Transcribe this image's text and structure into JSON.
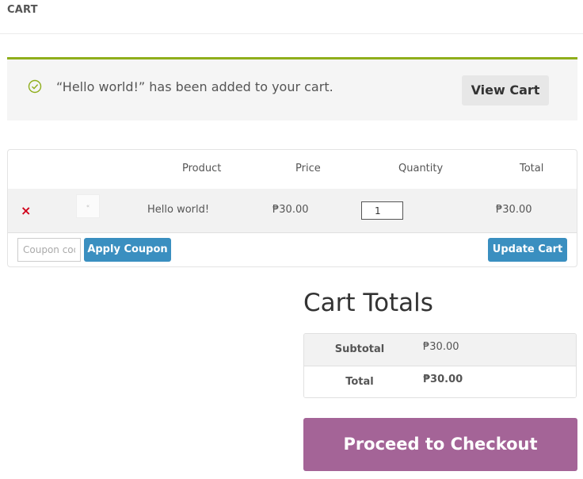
{
  "page": {
    "title": "CART"
  },
  "notice": {
    "message": "“Hello world!” has been added to your cart.",
    "view_cart_label": "View Cart",
    "accent_color": "#8fae1b",
    "icon": "check-circle-icon"
  },
  "cart": {
    "columns": {
      "product": "Product",
      "price": "Price",
      "quantity": "Quantity",
      "total": "Total"
    },
    "items": [
      {
        "remove_icon": "×",
        "thumb_text": "«",
        "name": "Hello world!",
        "price": "₱30.00",
        "quantity": "1",
        "total": "₱30.00"
      }
    ],
    "coupon_placeholder": "Coupon code",
    "apply_coupon_label": "Apply Coupon",
    "update_cart_label": "Update Cart",
    "button_color": "#3a8fc0"
  },
  "totals": {
    "title": "Cart Totals",
    "subtotal_label": "Subtotal",
    "subtotal_value": "₱30.00",
    "total_label": "Total",
    "total_value": "₱30.00"
  },
  "checkout": {
    "label": "Proceed to Checkout",
    "color": "#a46497"
  }
}
